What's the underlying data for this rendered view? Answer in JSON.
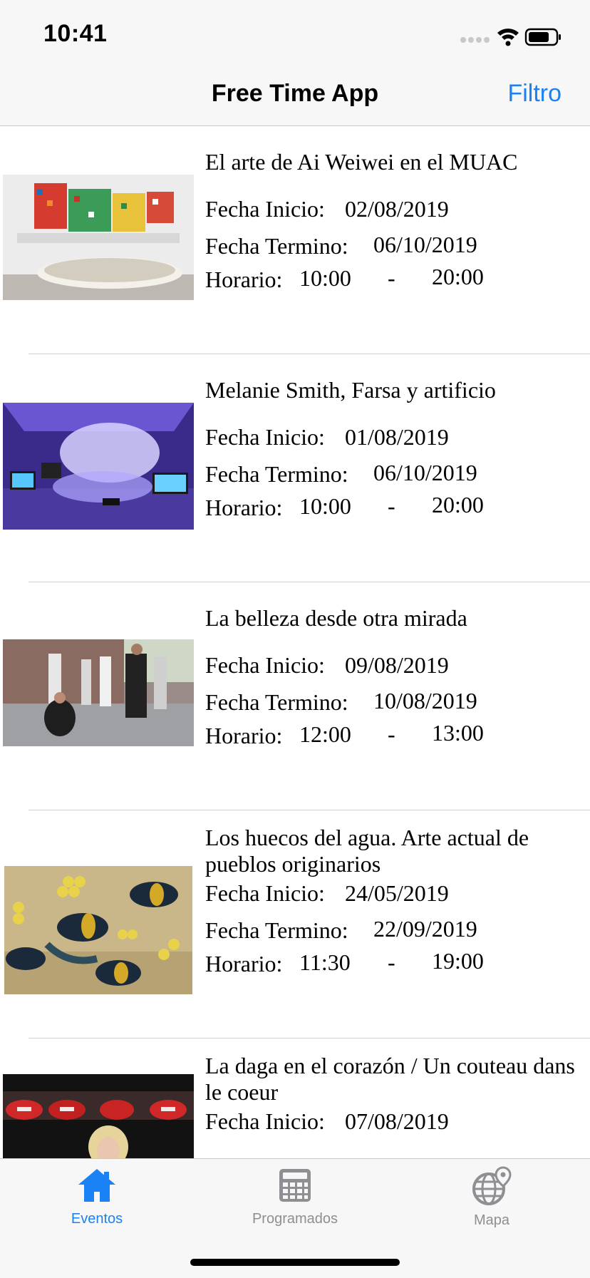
{
  "status": {
    "time": "10:41"
  },
  "nav": {
    "title": "Free Time App",
    "filter": "Filtro"
  },
  "labels": {
    "start": "Fecha Inicio:",
    "end": "Fecha Termino:",
    "schedule": "Horario:",
    "dash": "-"
  },
  "events": [
    {
      "title": "El arte de Ai Weiwei en el MUAC",
      "start": "02/08/2019",
      "end": "06/10/2019",
      "time_from": "10:00",
      "time_to": "20:00"
    },
    {
      "title": "Melanie Smith, Farsa y artificio",
      "start": "01/08/2019",
      "end": "06/10/2019",
      "time_from": "10:00",
      "time_to": "20:00"
    },
    {
      "title": "La belleza desde otra mirada",
      "start": "09/08/2019",
      "end": "10/08/2019",
      "time_from": "12:00",
      "time_to": "13:00"
    },
    {
      "title": "Los huecos del agua. Arte actual de pueblos originarios",
      "start": "24/05/2019",
      "end": "22/09/2019",
      "time_from": "11:30",
      "time_to": "19:00"
    },
    {
      "title": "La daga en el corazón / Un couteau dans le coeur",
      "start": "07/08/2019"
    }
  ],
  "tabs": [
    {
      "label": "Eventos",
      "icon": "home-icon",
      "active": true
    },
    {
      "label": "Programados",
      "icon": "calculator-icon",
      "active": false
    },
    {
      "label": "Mapa",
      "icon": "globe-pin-icon",
      "active": false
    }
  ],
  "colors": {
    "accent": "#1a82f5",
    "inactive": "#8e8e93",
    "bar": "#f7f7f7"
  }
}
